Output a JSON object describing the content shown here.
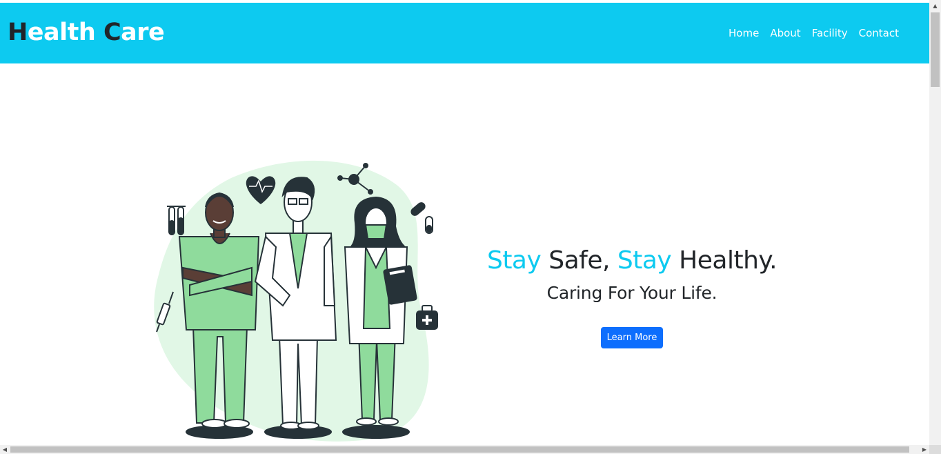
{
  "navbar": {
    "brand": {
      "h": "H",
      "ealth": "ealth ",
      "c": "C",
      "are": "are"
    },
    "links": [
      {
        "label": "Home"
      },
      {
        "label": "About"
      },
      {
        "label": "Facility"
      },
      {
        "label": "Contact"
      }
    ],
    "background": "#0dcaf0"
  },
  "hero": {
    "headline": {
      "w1": "Stay",
      "w2": " Safe, ",
      "w3": "Stay",
      "w4": " Healthy."
    },
    "subheadline": "Caring For Your Life.",
    "button_label": "Learn More",
    "accent_color": "#0dcaf0",
    "button_color": "#0d6efd",
    "illustration": "doctors-team-illustration"
  },
  "scrollbars": {
    "up": "▲",
    "down": "▼",
    "left": "◀",
    "right": "▶"
  }
}
